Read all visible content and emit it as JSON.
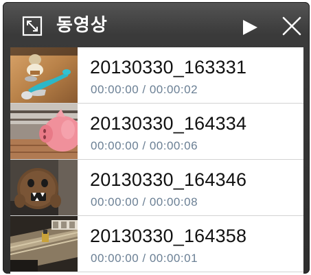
{
  "header": {
    "title": "동영상",
    "icons": [
      "expand-icon",
      "play-icon",
      "close-icon"
    ]
  },
  "videos": [
    {
      "name": "20130330_163331",
      "time": "00:00:00 / 00:00:02",
      "thumbnail": "toys-on-table-thumbnail"
    },
    {
      "name": "20130330_164334",
      "time": "00:00:00 / 00:00:06",
      "thumbnail": "pink-piggy-bank-thumbnail"
    },
    {
      "name": "20130330_164346",
      "time": "00:00:00 / 00:00:08",
      "thumbnail": "brown-plush-toy-thumbnail"
    },
    {
      "name": "20130330_164358",
      "time": "00:00:00 / 00:00:01",
      "thumbnail": "toy-train-track-thumbnail"
    }
  ],
  "colors": {
    "titlebar": "#3a3a3a",
    "title_text": "#ffffff",
    "filename_text": "#111111",
    "time_text": "#6a7f94",
    "divider": "#d2d2d2"
  }
}
